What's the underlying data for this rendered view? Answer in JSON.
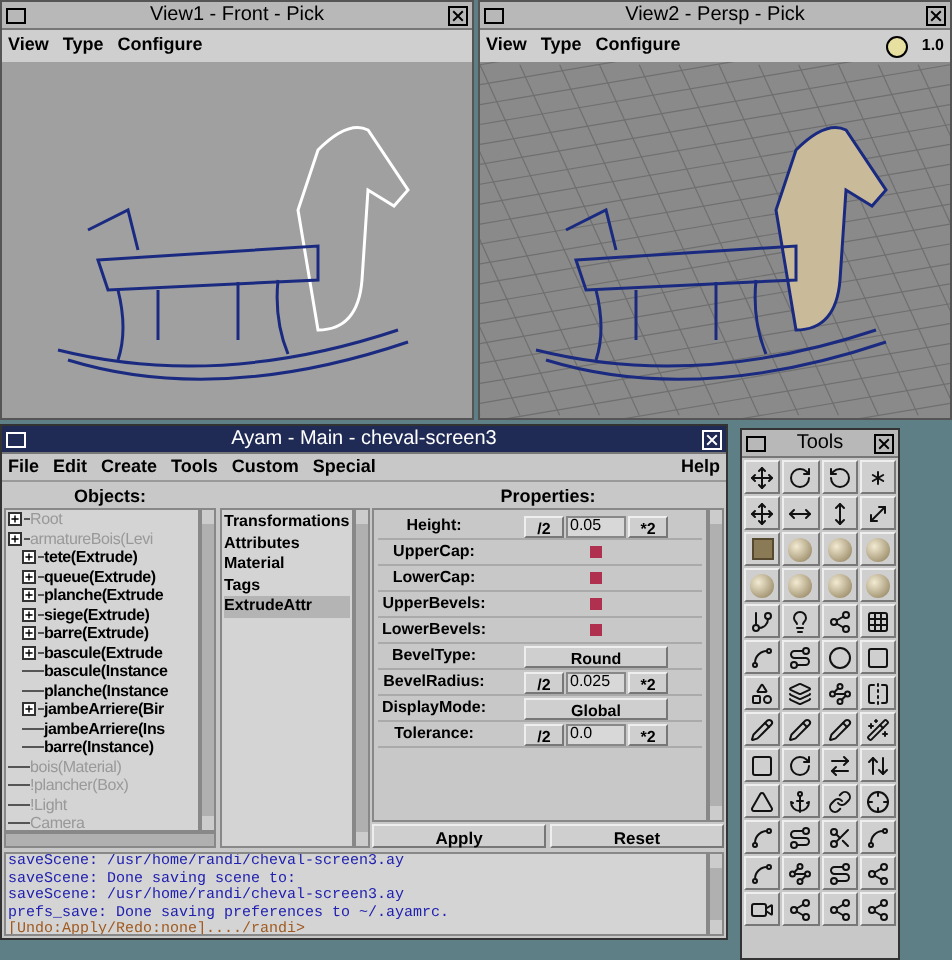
{
  "views": [
    {
      "title": "View1 - Front - Pick",
      "menu": [
        "View",
        "Type",
        "Configure"
      ],
      "kind": "front"
    },
    {
      "title": "View2 - Persp - Pick",
      "menu": [
        "View",
        "Type",
        "Configure"
      ],
      "kind": "persp",
      "zoom": "1.0"
    }
  ],
  "main": {
    "title": "Ayam - Main - cheval-screen3",
    "menu": [
      "File",
      "Edit",
      "Create",
      "Tools",
      "Custom",
      "Special"
    ],
    "help": "Help",
    "objects_label": "Objects:",
    "tree": [
      {
        "label": "Root",
        "selected": false,
        "expandable": true
      },
      {
        "label": "armatureBois(Levi",
        "selected": false,
        "expandable": true,
        "children": [
          {
            "label": "tete(Extrude)",
            "selected": true,
            "expandable": true
          },
          {
            "label": "queue(Extrude)",
            "selected": true,
            "expandable": true
          },
          {
            "label": "planche(Extrude",
            "selected": true,
            "expandable": true
          },
          {
            "label": "siege(Extrude)",
            "selected": true,
            "expandable": true
          },
          {
            "label": "barre(Extrude)",
            "selected": true,
            "expandable": true
          },
          {
            "label": "bascule(Extrude",
            "selected": true,
            "expandable": true
          },
          {
            "label": "bascule(Instance",
            "selected": true,
            "expandable": false
          },
          {
            "label": "planche(Instance",
            "selected": true,
            "expandable": false
          },
          {
            "label": "jambeArriere(Bir",
            "selected": true,
            "expandable": true
          },
          {
            "label": "jambeArriere(Ins",
            "selected": true,
            "expandable": false
          },
          {
            "label": "barre(Instance)",
            "selected": true,
            "expandable": false
          }
        ]
      },
      {
        "label": "bois(Material)",
        "selected": false,
        "expandable": false
      },
      {
        "label": "!plancher(Box)",
        "selected": false,
        "expandable": false
      },
      {
        "label": "!Light",
        "selected": false,
        "expandable": false
      },
      {
        "label": "Camera",
        "selected": false,
        "expandable": false
      }
    ],
    "property_list": [
      {
        "label": "Transformations",
        "selected": false
      },
      {
        "label": "Attributes",
        "selected": false
      },
      {
        "label": "Material",
        "selected": false
      },
      {
        "label": "Tags",
        "selected": false
      },
      {
        "label": "ExtrudeAttr",
        "selected": true
      }
    ],
    "properties_label": "Properties:",
    "properties": [
      {
        "label": "Height:",
        "kind": "number",
        "value": "0.05",
        "half": "/2",
        "double": "*2"
      },
      {
        "label": "UpperCap:",
        "kind": "check",
        "checked": true
      },
      {
        "label": "LowerCap:",
        "kind": "check",
        "checked": true
      },
      {
        "label": "UpperBevels:",
        "kind": "check",
        "checked": true
      },
      {
        "label": "LowerBevels:",
        "kind": "check",
        "checked": true
      },
      {
        "label": "BevelType:",
        "kind": "choice",
        "value": "Round"
      },
      {
        "label": "BevelRadius:",
        "kind": "number",
        "value": "0.025",
        "half": "/2",
        "double": "*2"
      },
      {
        "label": "DisplayMode:",
        "kind": "choice",
        "value": "Global"
      },
      {
        "label": "Tolerance:",
        "kind": "number",
        "value": "0.0",
        "half": "/2",
        "double": "*2"
      }
    ],
    "buttons": [
      "Apply",
      "Reset"
    ],
    "console": [
      {
        "text": "saveScene: /usr/home/randi/cheval-screen3.ay",
        "kind": "output"
      },
      {
        "text": "saveScene: Done saving scene to:",
        "kind": "output"
      },
      {
        "text": "saveScene: /usr/home/randi/cheval-screen3.ay",
        "kind": "output"
      },
      {
        "text": "prefs_save: Done saving preferences to ~/.ayamrc.",
        "kind": "output"
      },
      {
        "text": "[Undo:Apply/Redo:none]..../randi>",
        "kind": "prompt"
      }
    ]
  },
  "tools": {
    "title": "Tools"
  }
}
